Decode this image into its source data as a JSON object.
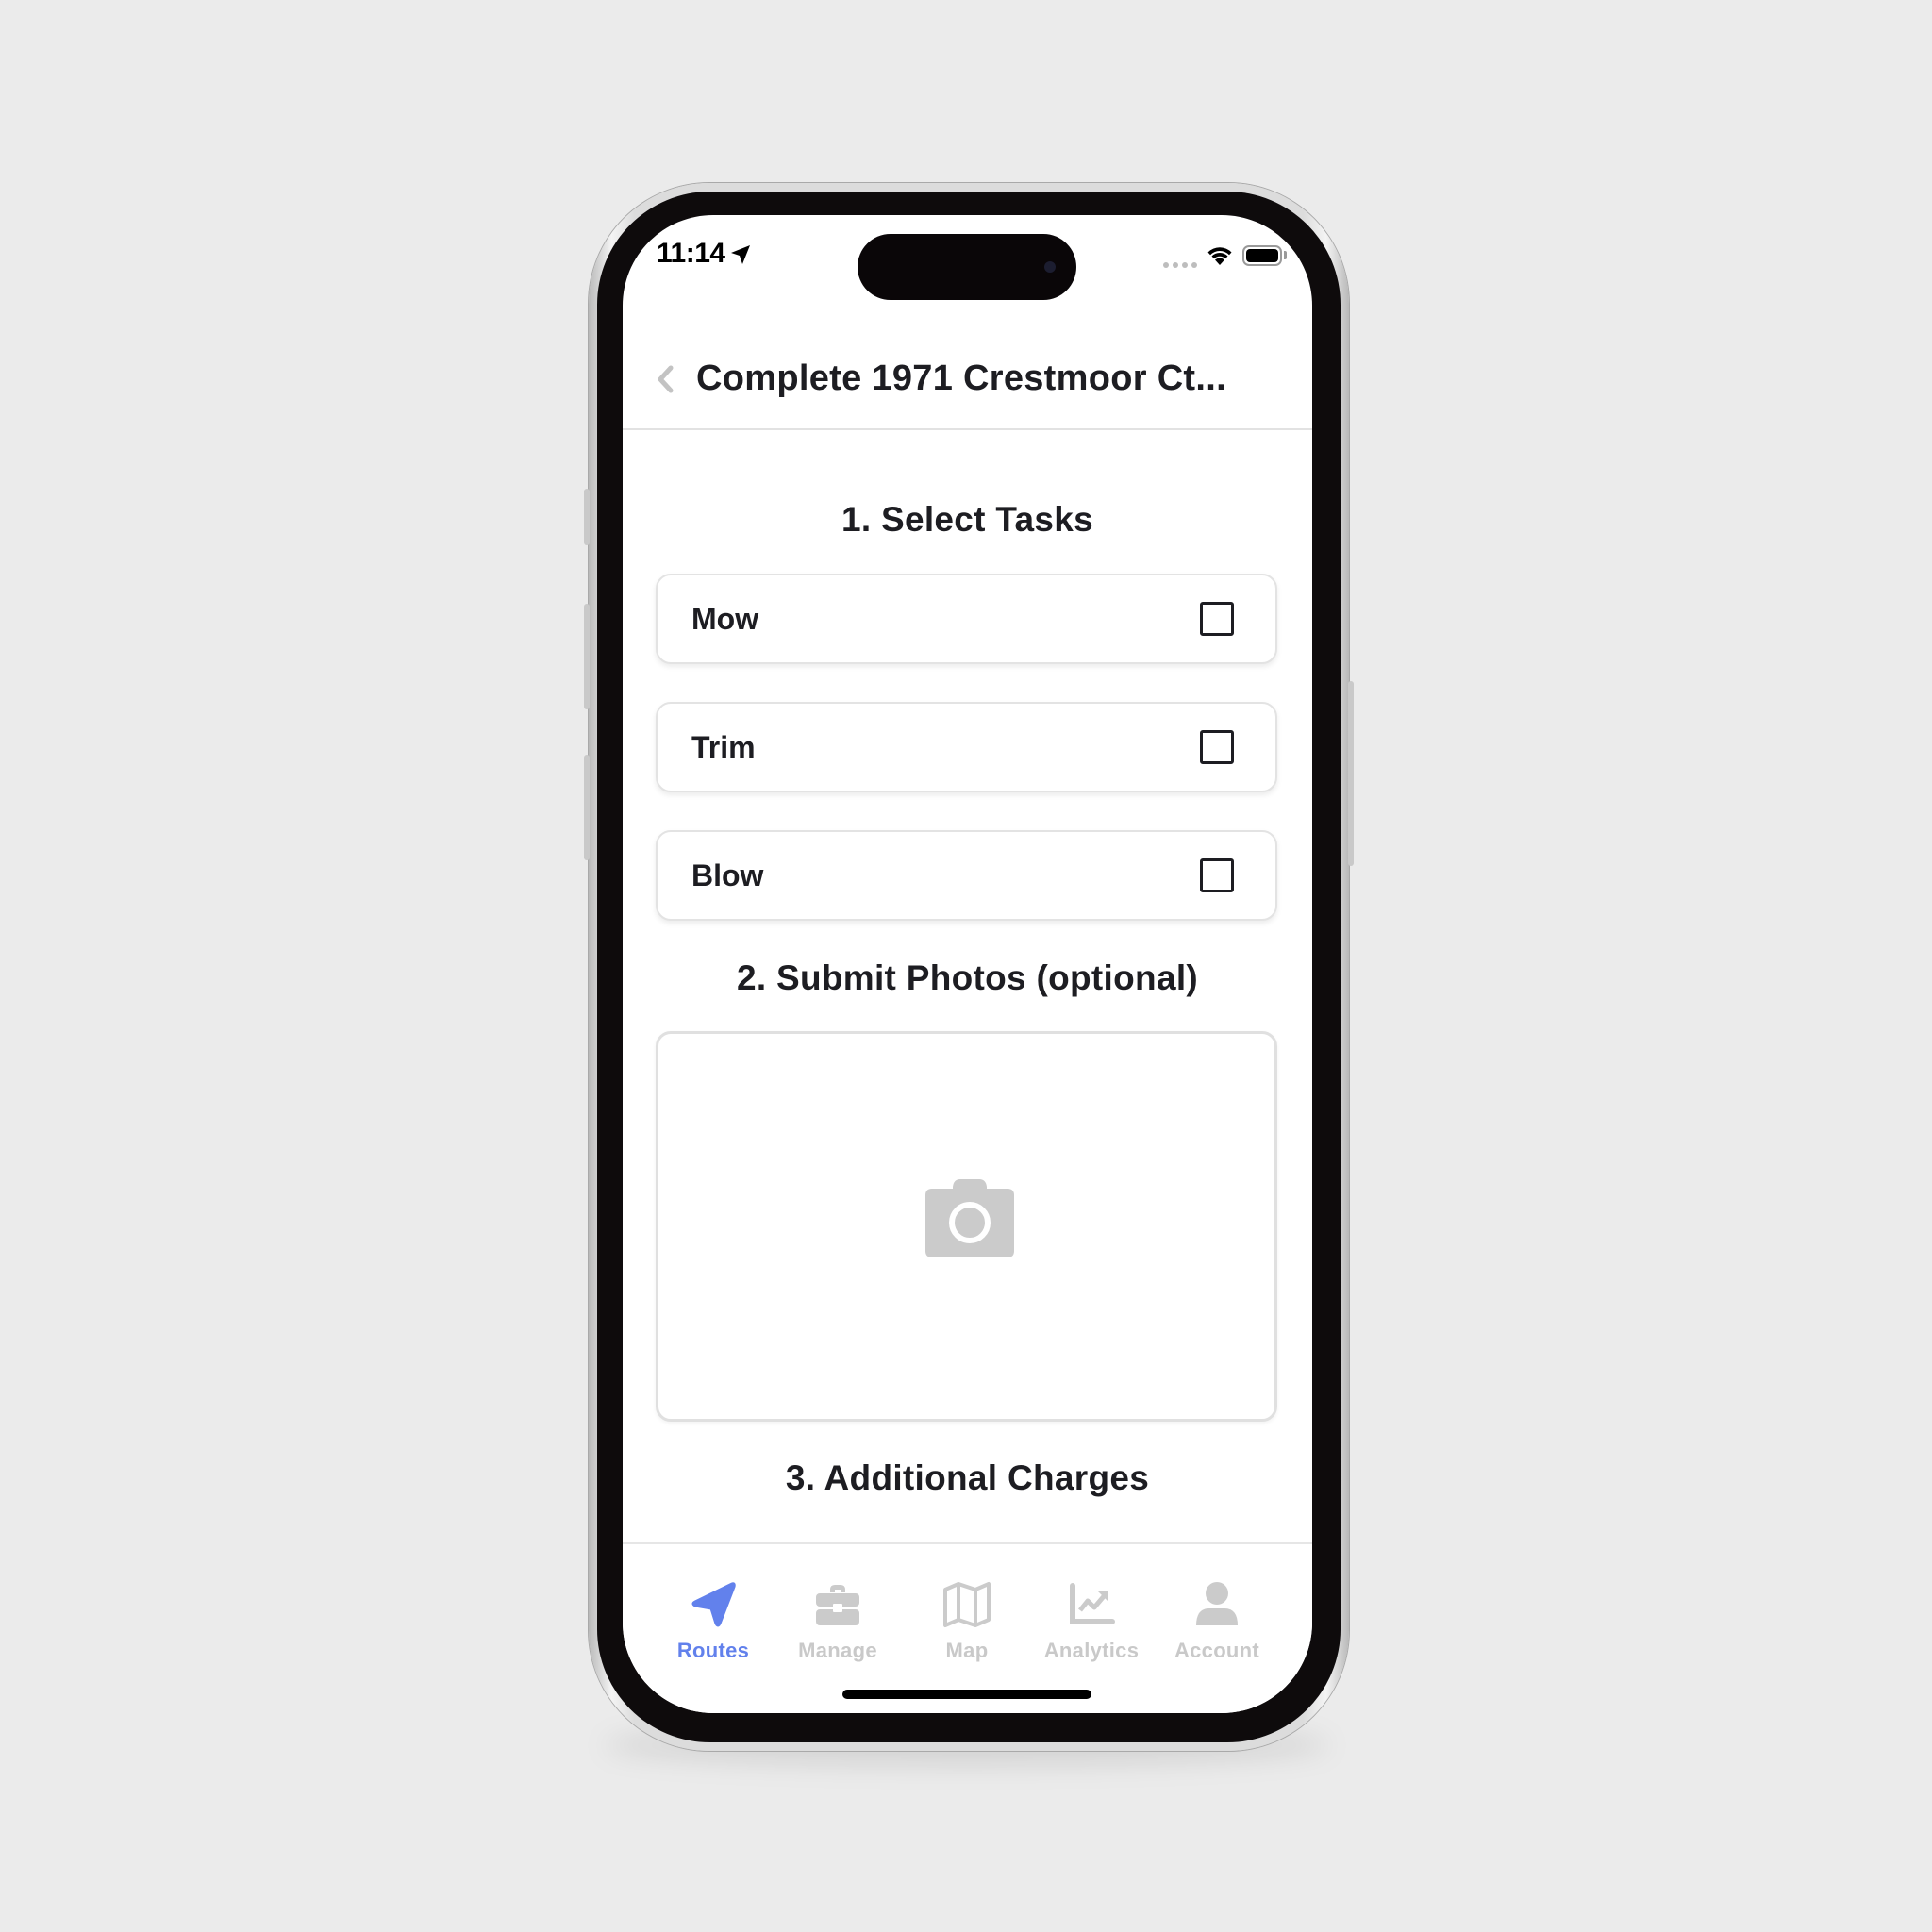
{
  "status_bar": {
    "time": "11:14",
    "location_icon": "location-arrow-icon",
    "signal_icon": "cellular-signal-icon",
    "wifi_icon": "wifi-icon",
    "battery_icon": "battery-icon",
    "battery_level": 1.0
  },
  "header": {
    "back_icon": "chevron-left-icon",
    "title": "Complete 1971 Crestmoor Ct..."
  },
  "sections": {
    "tasks": {
      "title": "1. Select Tasks",
      "items": [
        {
          "label": "Mow",
          "checked": false
        },
        {
          "label": "Trim",
          "checked": false
        },
        {
          "label": "Blow",
          "checked": false
        }
      ]
    },
    "photos": {
      "title": "2. Submit Photos (optional)",
      "icon": "camera-icon"
    },
    "charges": {
      "title": "3. Additional Charges"
    }
  },
  "tabbar": {
    "active_color": "#6281ec",
    "inactive_color": "#c9c9c9",
    "tabs": [
      {
        "label": "Routes",
        "icon": "navigation-arrow-icon",
        "active": true
      },
      {
        "label": "Manage",
        "icon": "briefcase-icon",
        "active": false
      },
      {
        "label": "Map",
        "icon": "map-icon",
        "active": false
      },
      {
        "label": "Analytics",
        "icon": "chart-line-icon",
        "active": false
      },
      {
        "label": "Account",
        "icon": "user-icon",
        "active": false
      }
    ]
  }
}
